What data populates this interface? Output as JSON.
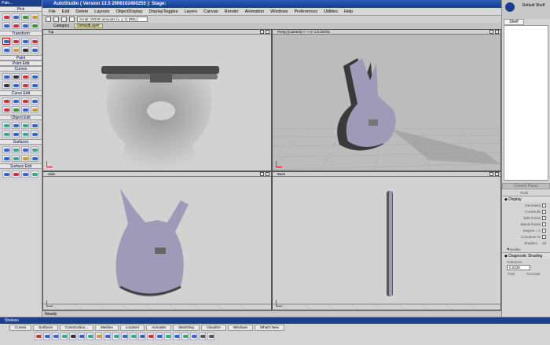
{
  "app": {
    "title": "AutoStudio ( Version 13.5  2006102400255 ): Stage:",
    "status": "Newdy"
  },
  "menu": [
    "File",
    "Edit",
    "Delete",
    "Layouts",
    "ObjectDisplay",
    "DisplayToggles",
    "Layers",
    "Canvas",
    "Render",
    "Animation",
    "Windows",
    "Preferences",
    "Utilities",
    "Help"
  ],
  "toolbar": {
    "script_text": "Script: MOVE amounts (x, y, z) (REL):",
    "category_label": "Category",
    "layer_label": "DefaultLayer"
  },
  "palette": {
    "title": "Pale...",
    "sections": [
      "Pick",
      "Transform",
      "Paint",
      "Point Edit",
      "Curves",
      "Curve Edit",
      "Object Edit",
      "Surfaces",
      "Surface Edit"
    ]
  },
  "viewports": {
    "top": {
      "label": "Top"
    },
    "persp": {
      "label": "Persp [Camera] <--> in  1:0.03701"
    },
    "side": {
      "label": "Side"
    },
    "back": {
      "label": "Back"
    }
  },
  "shelf": {
    "header": "Default Shelf",
    "tab": "Shelf",
    "control_title": "Control Panel",
    "tools_label": "Tools",
    "display_label": "Display",
    "display_items": [
      "Geometry",
      "CVs/Hulls",
      "Edit Points",
      "Blend Points",
      "Degree = 1",
      "Curvature %",
      "Shaders",
      "Quality"
    ],
    "shaders_value": "All",
    "diag_label": "Diagnostic Shading",
    "tolerance_label": "Tolerance",
    "tolerance_value": "0.0039",
    "fast_label": "Fast",
    "accurate_label": "Accurate"
  },
  "shelves": {
    "title": "Shelves",
    "tabs": [
      "Curves",
      "Surfaces",
      "Construction...",
      "Meshes",
      "Locators",
      "Annotate",
      "Sketching",
      "Visualize",
      "Windows",
      "What's New"
    ]
  },
  "colors": {
    "title_blue": "#1c3f8c",
    "guitar_body": "#9e9ab8",
    "persp_bg": "#bcbcbc",
    "ortho_bg": "#d2d2d2"
  }
}
